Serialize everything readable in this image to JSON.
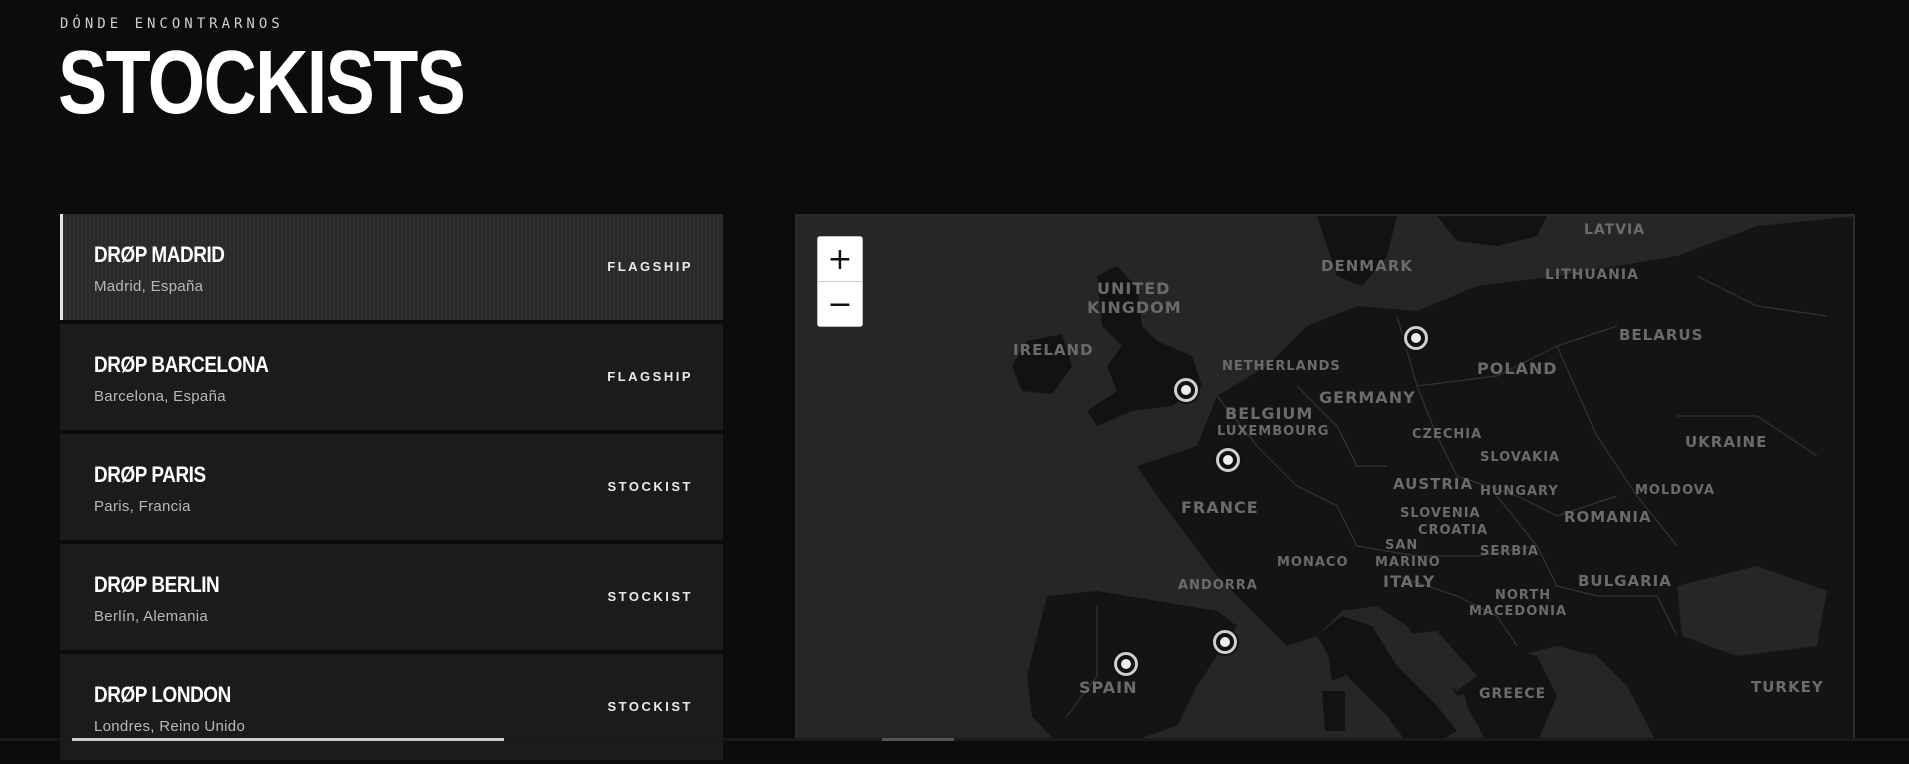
{
  "header": {
    "eyebrow": "DÓNDE ENCONTRARNOS",
    "title": "STOCKISTS"
  },
  "stores": [
    {
      "name": "DRØP MADRID",
      "city": "Madrid, España",
      "type": "FLAGSHIP",
      "active": true
    },
    {
      "name": "DRØP BARCELONA",
      "city": "Barcelona, España",
      "type": "FLAGSHIP",
      "active": false
    },
    {
      "name": "DRØP PARIS",
      "city": "Paris, Francia",
      "type": "STOCKIST",
      "active": false
    },
    {
      "name": "DRØP BERLIN",
      "city": "Berlín, Alemania",
      "type": "STOCKIST",
      "active": false
    },
    {
      "name": "DRØP LONDON",
      "city": "Londres, Reino Unido",
      "type": "STOCKIST",
      "active": false
    }
  ],
  "map": {
    "zoom_in": "+",
    "zoom_out": "−",
    "labels": {
      "latvia": "LATVIA",
      "denmark": "DENMARK",
      "lithuania": "LITHUANIA",
      "united": "UNITED",
      "kingdom": "KINGDOM",
      "belarus": "BELARUS",
      "ireland": "IRELAND",
      "netherlands": "NETHERLANDS",
      "poland": "POLAND",
      "germany": "GERMANY",
      "belgium": "BELGIUM",
      "luxembourg": "LUXEMBOURG",
      "czechia": "CZECHIA",
      "ukraine": "UKRAINE",
      "slovakia": "SLOVAKIA",
      "austria": "AUSTRIA",
      "moldova": "MOLDOVA",
      "hungary": "HUNGARY",
      "france": "FRANCE",
      "slovenia": "SLOVENIA",
      "romania": "ROMANIA",
      "croatia": "CROATIA",
      "san": "SAN",
      "marino": "MARINO",
      "serbia": "SERBIA",
      "monaco": "MONACO",
      "andorra": "ANDORRA",
      "italy": "ITALY",
      "bulgaria": "BULGARIA",
      "north": "NORTH",
      "macedonia": "MACEDONIA",
      "spain": "SPAIN",
      "greece": "GREECE",
      "turkey": "TURKEY"
    }
  }
}
